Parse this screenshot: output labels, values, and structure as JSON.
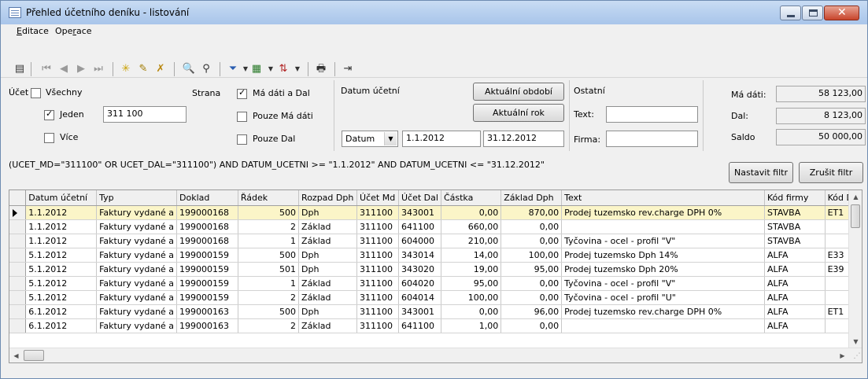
{
  "window": {
    "title": "Přehled účetního deníku - listování",
    "controls": {
      "minimize_icon": "minimize-icon",
      "maximize_icon": "maximize-icon",
      "close_icon": "close-icon"
    }
  },
  "menu": [
    {
      "label_pre": "",
      "label_ul": "E",
      "label_post": "ditace"
    },
    {
      "label_pre": "Ope",
      "label_ul": "r",
      "label_post": "ace"
    }
  ],
  "toolbar": {
    "icons": [
      "table-icon",
      "first-record-icon",
      "previous-record-icon",
      "next-record-icon",
      "last-record-icon",
      "new-record-icon",
      "edit-record-icon",
      "delete-record-icon",
      "find-icon",
      "find-next-icon",
      "filter-icon",
      "export-icon",
      "sort-icon",
      "print-icon",
      "exit-icon"
    ]
  },
  "filter": {
    "ucet_label": "Účet",
    "vsechny_label": "Všechny",
    "vsechny_checked": false,
    "jeden_label": "Jeden",
    "jeden_checked": true,
    "jeden_value": "311 100",
    "vice_label": "Více",
    "vice_checked": false,
    "strana_label": "Strana",
    "ma_dati_a_dal_label": "Má dáti a Dal",
    "ma_dati_a_dal_checked": true,
    "pouze_ma_dati_label": "Pouze Má dáti",
    "pouze_ma_dati_checked": false,
    "pouze_dal_label": "Pouze Dal",
    "pouze_dal_checked": false,
    "datum_ucetni_label": "Datum účetní",
    "aktualni_obdobi_label": "Aktuální období",
    "aktualni_rok_label": "Aktuální rok",
    "datum_select_value": "Datum",
    "date_from": "1.1.2012",
    "date_to": "31.12.2012",
    "ostatni_label": "Ostatní",
    "text_label": "Text:",
    "text_value": "",
    "firma_label": "Firma:",
    "firma_value": "",
    "ma_dati_label": "Má dáti:",
    "ma_dati_value": "58 123,00",
    "dal_label": "Dal:",
    "dal_value": "8 123,00",
    "saldo_label": "Saldo",
    "saldo_value": "50 000,00"
  },
  "expression": "(UCET_MD=\"311100\" OR UCET_DAL=\"311100\") AND DATUM_UCETNI >= \"1.1.2012\" AND DATUM_UCETNI <= \"31.12.2012\"",
  "buttons": {
    "set_filter": "Nastavit filtr",
    "clear_filter": "Zrušit filtr"
  },
  "grid": {
    "columns": [
      "Datum účetní",
      "Typ",
      "Doklad",
      "Řádek",
      "Rozpad Dph",
      "Účet Md",
      "Účet Dal",
      "Částka",
      "Základ Dph",
      "Text",
      "Kód firmy",
      "Kód Dp"
    ],
    "rows": [
      [
        "1.1.2012",
        "Faktury vydané a",
        "199000168",
        "500",
        "Dph",
        "311100",
        "343001",
        "0,00",
        "870,00",
        "Prodej tuzemsko rev.charge DPH 0%",
        "STAVBA",
        "ET1"
      ],
      [
        "1.1.2012",
        "Faktury vydané a",
        "199000168",
        "2",
        "Základ",
        "311100",
        "641100",
        "660,00",
        "0,00",
        "",
        "STAVBA",
        ""
      ],
      [
        "1.1.2012",
        "Faktury vydané a",
        "199000168",
        "1",
        "Základ",
        "311100",
        "604000",
        "210,00",
        "0,00",
        "Tyčovina - ocel - profil \"V\"",
        "STAVBA",
        ""
      ],
      [
        "5.1.2012",
        "Faktury vydané a",
        "199000159",
        "500",
        "Dph",
        "311100",
        "343014",
        "14,00",
        "100,00",
        "Prodej tuzemsko  Dph 14%",
        "ALFA",
        "E33"
      ],
      [
        "5.1.2012",
        "Faktury vydané a",
        "199000159",
        "501",
        "Dph",
        "311100",
        "343020",
        "19,00",
        "95,00",
        "Prodej tuzemsko  Dph 20%",
        "ALFA",
        "E39"
      ],
      [
        "5.1.2012",
        "Faktury vydané a",
        "199000159",
        "1",
        "Základ",
        "311100",
        "604020",
        "95,00",
        "0,00",
        "Tyčovina - ocel - profil \"V\"",
        "ALFA",
        ""
      ],
      [
        "5.1.2012",
        "Faktury vydané a",
        "199000159",
        "2",
        "Základ",
        "311100",
        "604014",
        "100,00",
        "0,00",
        "Tyčovina - ocel - profil \"U\"",
        "ALFA",
        ""
      ],
      [
        "6.1.2012",
        "Faktury vydané a",
        "199000163",
        "500",
        "Dph",
        "311100",
        "343001",
        "0,00",
        "96,00",
        "Prodej tuzemsko rev.charge DPH 0%",
        "ALFA",
        "ET1"
      ],
      [
        "6.1.2012",
        "Faktury vydané a",
        "199000163",
        "2",
        "Základ",
        "311100",
        "641100",
        "1,00",
        "0,00",
        "",
        "ALFA",
        ""
      ]
    ],
    "selected_row": 0
  }
}
